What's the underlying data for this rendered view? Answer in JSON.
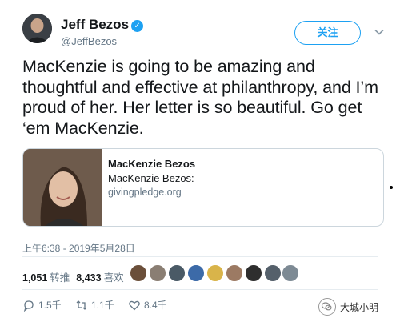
{
  "author": {
    "name": "Jeff Bezos",
    "handle": "@JeffBezos",
    "verified_icon": "verified-badge-icon"
  },
  "follow_button": {
    "label": "关注"
  },
  "tweet": {
    "text": "MacKenzie is going to be amazing and thoughtful and effective at philanthropy, and I’m proud of her. Her letter is so beautiful. Go get ‘em MacKenzie."
  },
  "card": {
    "title": "MacKenzie Bezos",
    "description": "MacKenzie Bezos:",
    "domain": "givingpledge.org"
  },
  "timestamp": "上午6:38 - 2019年5月28日",
  "stats": {
    "retweets": "1,051",
    "retweets_label": "转推",
    "likes": "8,433",
    "likes_label": "喜欢"
  },
  "likers": [
    {
      "color": "#6b4f3a"
    },
    {
      "color": "#8a7e73"
    },
    {
      "color": "#4a5a66"
    },
    {
      "color": "#3c6aa8"
    },
    {
      "color": "#d9b44a"
    },
    {
      "color": "#9c7a63"
    },
    {
      "color": "#2e2e2e"
    },
    {
      "color": "#55606b"
    },
    {
      "color": "#7d8a94"
    }
  ],
  "actions": {
    "reply_count": "1.5千",
    "retweet_count": "1.1千",
    "like_count": "8.4千"
  },
  "watermark": {
    "text": "大城小明"
  },
  "colors": {
    "accent": "#1da1f2",
    "muted": "#657786",
    "border": "#ccd6dd"
  }
}
